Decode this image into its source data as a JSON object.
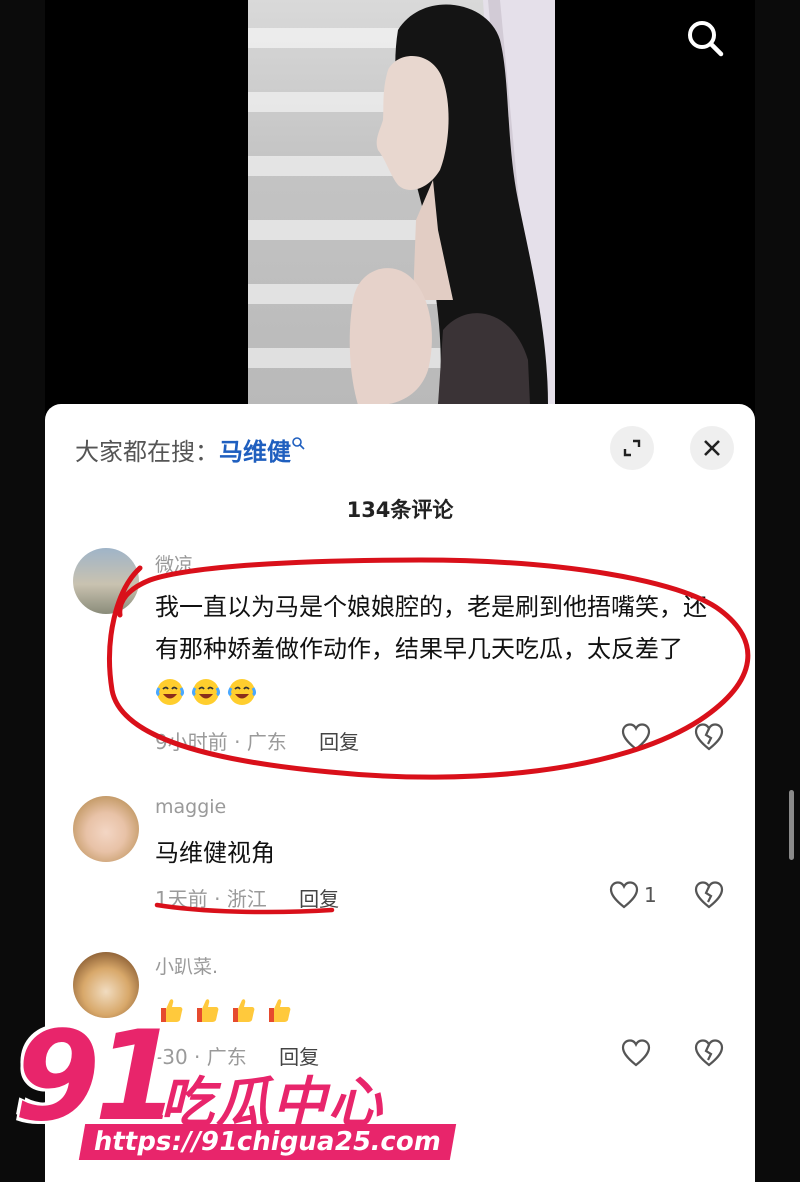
{
  "sheet": {
    "hot_search_prefix": "大家都在搜：",
    "hot_search_term": "马维健",
    "comment_count": "134条评论"
  },
  "comments": [
    {
      "user": "微凉",
      "text": "我一直以为马是个娘娘腔的，老是刷到他捂嘴笑，还有那种娇羞做作动作，结果早几天吃瓜，太反差了",
      "emojis": [
        "laugh-cry-emoji",
        "laugh-cry-emoji",
        "laugh-cry-emoji"
      ],
      "time": "9小时前",
      "location": "广东",
      "reply": "回复",
      "likes": ""
    },
    {
      "user": "maggie",
      "text": "马维健视角",
      "time": "1天前",
      "location": "浙江",
      "reply": "回复",
      "likes": "1"
    },
    {
      "user": "小趴菜.",
      "emojis": [
        "thumbs-up-emoji",
        "thumbs-up-emoji",
        "thumbs-up-emoji",
        "thumbs-up-emoji"
      ],
      "time": "-30",
      "location": "广东",
      "reply": "回复",
      "likes": ""
    }
  ],
  "watermark": {
    "number": "91",
    "name": "吃瓜中心",
    "url": "https://91chigua25.com"
  },
  "colors": {
    "link_blue": "#1f5fbf",
    "annotation_red": "#d9101a",
    "watermark_pink": "#e8256b"
  }
}
